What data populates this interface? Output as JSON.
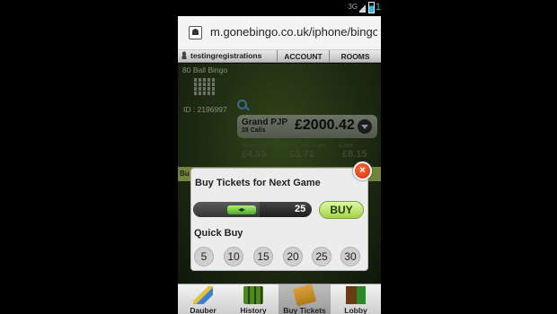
{
  "status_bar": {
    "signal_label": "3G",
    "clock_partial": "1"
  },
  "browser": {
    "url": "m.gonebingo.co.uk/iphone/bingo"
  },
  "game_header": {
    "username": "testingregistrations",
    "tabs": [
      "ACCOUNT",
      "ROOMS"
    ]
  },
  "game": {
    "game_type": "80 Ball Bingo",
    "game_id": "ID : 2196997",
    "jackpot": {
      "name": "Grand PJP",
      "calls": "28 Calls",
      "amount": "£2000.42"
    },
    "prizes": [
      {
        "label": "Any Line",
        "value": "£4.89"
      },
      {
        "label": "Any Two Line",
        "value": "£5.71"
      },
      {
        "label": "Line",
        "value": "£8.15"
      }
    ],
    "strip_label": "Bu"
  },
  "modal": {
    "title": "Buy Tickets for Next Game",
    "close_label": "×",
    "slider": {
      "value": 25,
      "fill_fraction": 0.33,
      "thumb_glyph": "◂▸"
    },
    "buy_label": "BUY",
    "quick_buy_title": "Quick Buy",
    "quick_buy_options": [
      "5",
      "10",
      "15",
      "20",
      "25",
      "30"
    ]
  },
  "bottom_nav": {
    "items": [
      {
        "label": "Dauber",
        "icon": "dauber-icon"
      },
      {
        "label": "History",
        "icon": "history-icon"
      },
      {
        "label": "Buy Tickets",
        "icon": "ticket-icon",
        "active": true
      },
      {
        "label": "Lobby",
        "icon": "door-icon"
      }
    ]
  }
}
